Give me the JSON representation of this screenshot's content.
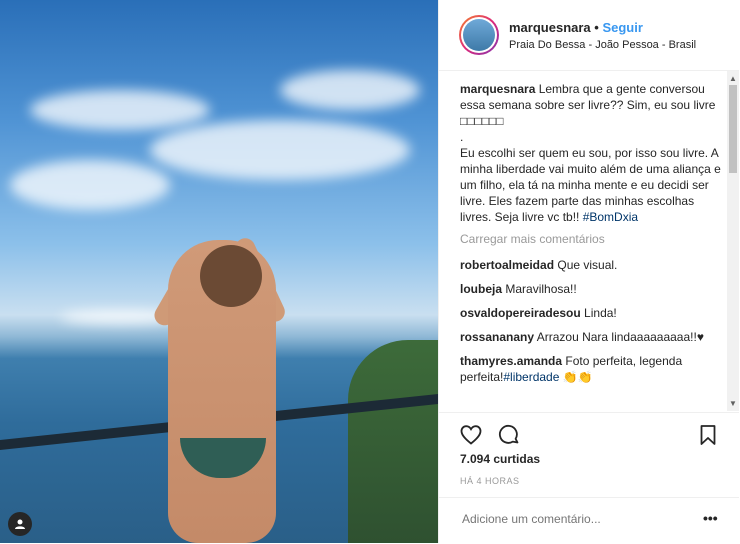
{
  "post": {
    "username": "marquesnara",
    "separator": "•",
    "follow_label": "Seguir",
    "location": "Praia Do Bessa - João Pessoa - Brasil"
  },
  "caption": {
    "username": "marquesnara",
    "text": " Lembra que a gente conversou essa semana sobre ser livre?? Sim, eu sou livre □□□□□□\n.\nEu escolhi ser quem eu sou, por isso sou livre. A minha liberdade vai muito além de uma aliança e um filho, ela tá na minha mente e eu decidi ser livre. Eles fazem parte das minhas escolhas livres. Seja livre vc tb!! ",
    "hashtag": "#BomDxia"
  },
  "load_more": "Carregar mais comentários",
  "comments": [
    {
      "user": "robertoalmeidad",
      "text": " Que visual."
    },
    {
      "user": "loubeja",
      "text": " Maravilhosa!!"
    },
    {
      "user": "osvaldopereiradesou",
      "text": " Linda!"
    },
    {
      "user": "rossananany",
      "text": " Arrazou Nara lindaaaaaaaaa!!♥"
    },
    {
      "user": "thamyres.amanda",
      "text": " Foto perfeita, legenda perfeita!",
      "hashtag": "#liberdade",
      "tail": " 👏👏"
    }
  ],
  "likes": "7.094 curtidas",
  "time": "HÁ 4 HORAS",
  "add_comment_placeholder": "Adicione um comentário...",
  "more_label": "•••",
  "icons": {
    "like": "heart-icon",
    "comment": "comment-icon",
    "save": "bookmark-icon",
    "user_tag": "user-tag-icon"
  },
  "colors": {
    "follow": "#3897f0",
    "hashtag": "#003569",
    "muted": "#999999"
  }
}
